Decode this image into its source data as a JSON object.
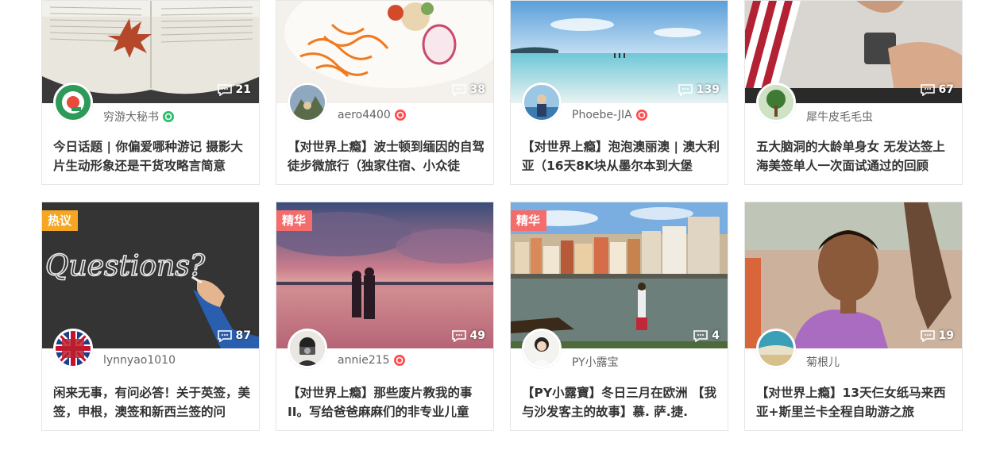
{
  "cards": [
    {
      "author": "穷游大秘书",
      "badge": "green",
      "comments": "21",
      "title": "今日话题 | 你偏爱哪种游记 摄影大片生动形象还是干货攻略言简意"
    },
    {
      "author": "aero4400",
      "badge": "red",
      "comments": "38",
      "title": "【对世界上瘾】波士顿到缅因的自驾徒步微旅行（独家住宿、小众徒"
    },
    {
      "author": "Phoebe-JIA",
      "badge": "red",
      "comments": "139",
      "title": "【对世界上瘾】泡泡澳丽澳 | 澳大利亚（16天8K块从墨尔本到大堡"
    },
    {
      "author": "犀牛皮毛毛虫",
      "badge": "",
      "comments": "67",
      "title": "五大脑洞的大龄单身女 无发达签上海美签单人一次面试通过的回顾"
    },
    {
      "author": "lynnyao1010",
      "badge": "",
      "comments": "87",
      "tag": "热议",
      "title": "闲来无事，有问必答！关于英签，美签，申根，澳签和新西兰签的问"
    },
    {
      "author": "annie215",
      "badge": "red",
      "comments": "49",
      "tag": "精华",
      "title": "【对世界上瘾】那些废片教我的事II。写给爸爸麻麻们的非专业儿童"
    },
    {
      "author": "PY小露宝",
      "badge": "",
      "comments": "4",
      "tag": "精华",
      "title": "【PY小露寶】冬日三月在欧洲 【我与沙发客主的故事】慕. 萨.捷."
    },
    {
      "author": "菊根儿",
      "badge": "",
      "comments": "19",
      "title": "【对世界上瘾】13天仨女纸马来西亚+斯里兰卡全程自助游之旅"
    }
  ],
  "colors": {
    "hot_tag": "#f5a623",
    "best_tag": "#f56c6c",
    "verified_green": "#2bbf6b",
    "verified_red": "#ff4d4f"
  }
}
